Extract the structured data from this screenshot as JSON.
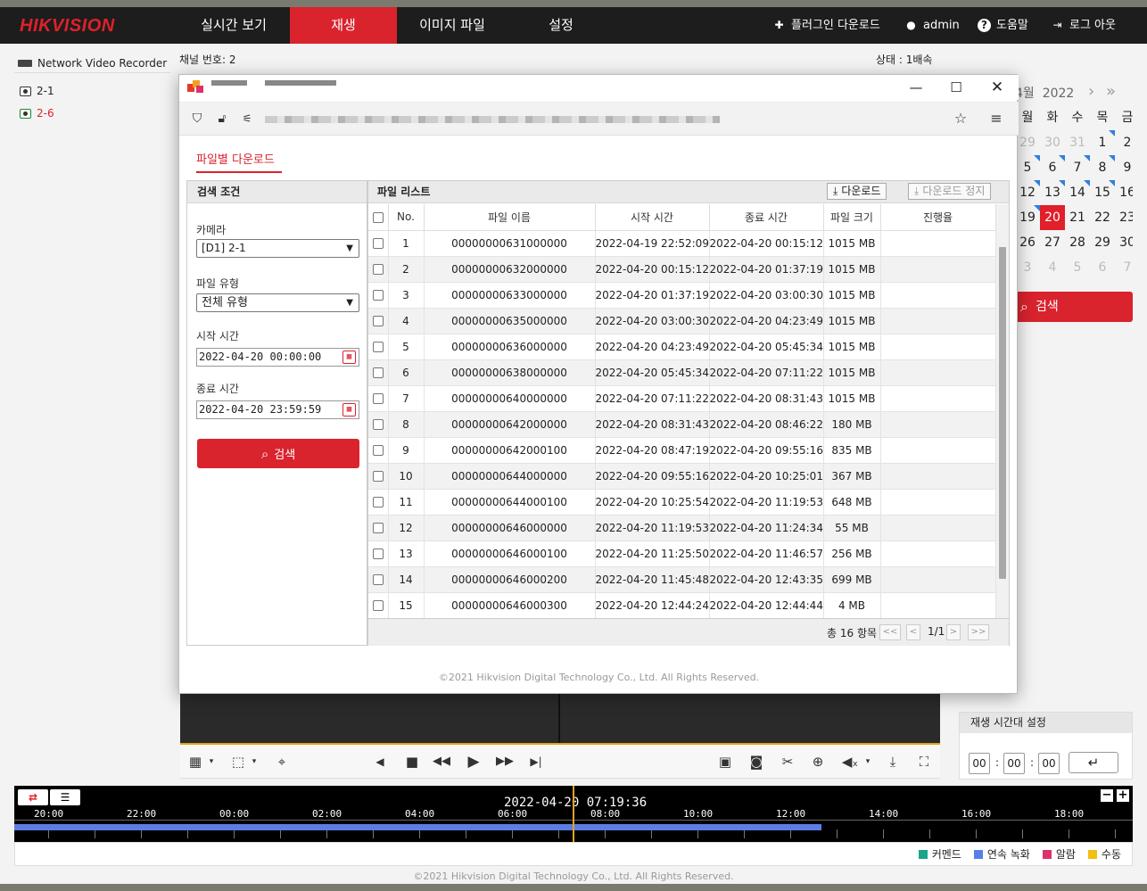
{
  "header": {
    "logo": "HIKVISION",
    "tabs": [
      "실시간 보기",
      "재생",
      "이미지 파일",
      "설정"
    ],
    "active_tab": "재생",
    "plugin": "플러그인 다운로드",
    "user": "admin",
    "help": "도움말",
    "logout": "로그 아웃"
  },
  "sidebar": {
    "device": "Network Video Recorder",
    "cameras": [
      "2-1",
      "2-6"
    ]
  },
  "playback": {
    "channel_label": "채널 번호: 2",
    "status_label": "상태 : 1배속"
  },
  "calendar": {
    "title": "4월  2022",
    "weekdays": [
      "월",
      "화",
      "수",
      "목",
      "금"
    ],
    "weeks": [
      [
        "29",
        "30",
        "31",
        "1",
        "2"
      ],
      [
        "5",
        "6",
        "7",
        "8",
        "9"
      ],
      [
        "12",
        "13",
        "14",
        "15",
        "16"
      ],
      [
        "19",
        "20",
        "21",
        "22",
        "23"
      ],
      [
        "26",
        "27",
        "28",
        "29",
        "30"
      ],
      [
        "3",
        "4",
        "5",
        "6",
        "7"
      ]
    ],
    "selected": "20",
    "search_label": "검색"
  },
  "time_setting": {
    "title": "재생 시간대 설정",
    "hh": "00",
    "mm": "00",
    "ss": "00"
  },
  "timeline": {
    "current_time": "2022-04-20 07:19:36",
    "hours": [
      "20:00",
      "22:00",
      "00:00",
      "02:00",
      "04:00",
      "06:00",
      "08:00",
      "10:00",
      "12:00",
      "14:00",
      "16:00",
      "18:00"
    ],
    "legend": [
      {
        "label": "커멘드",
        "color": "#1aa58a"
      },
      {
        "label": "연속 녹화",
        "color": "#5b7ee6"
      },
      {
        "label": "알람",
        "color": "#e0306a"
      },
      {
        "label": "수동",
        "color": "#f2c012"
      }
    ]
  },
  "footer": "©2021 Hikvision Digital Technology Co., Ltd. All Rights Reserved.",
  "popup": {
    "tab_label": "파일별 다운로드",
    "search_panel": {
      "title": "검색 조건",
      "camera_label": "카메라",
      "camera_value": "[D1] 2-1",
      "file_type_label": "파일 유형",
      "file_type_value": "전체 유형",
      "start_label": "시작 시간",
      "start_value": "2022-04-20 00:00:00",
      "end_label": "종료 시간",
      "end_value": "2022-04-20 23:59:59",
      "search_button": "검색"
    },
    "file_list": {
      "title": "파일 리스트",
      "download_button": "다운로드",
      "stop_button": "다운로드 정지",
      "columns": [
        "No.",
        "파일 이름",
        "시작 시간",
        "종료 시간",
        "파일 크기",
        "진행율"
      ],
      "rows": [
        [
          "1",
          "00000000631000000",
          "2022-04-19 22:52:09",
          "2022-04-20 00:15:12",
          "1015 MB"
        ],
        [
          "2",
          "00000000632000000",
          "2022-04-20 00:15:12",
          "2022-04-20 01:37:19",
          "1015 MB"
        ],
        [
          "3",
          "00000000633000000",
          "2022-04-20 01:37:19",
          "2022-04-20 03:00:30",
          "1015 MB"
        ],
        [
          "4",
          "00000000635000000",
          "2022-04-20 03:00:30",
          "2022-04-20 04:23:49",
          "1015 MB"
        ],
        [
          "5",
          "00000000636000000",
          "2022-04-20 04:23:49",
          "2022-04-20 05:45:34",
          "1015 MB"
        ],
        [
          "6",
          "00000000638000000",
          "2022-04-20 05:45:34",
          "2022-04-20 07:11:22",
          "1015 MB"
        ],
        [
          "7",
          "00000000640000000",
          "2022-04-20 07:11:22",
          "2022-04-20 08:31:43",
          "1015 MB"
        ],
        [
          "8",
          "00000000642000000",
          "2022-04-20 08:31:43",
          "2022-04-20 08:46:22",
          "180 MB"
        ],
        [
          "9",
          "00000000642000100",
          "2022-04-20 08:47:19",
          "2022-04-20 09:55:16",
          "835 MB"
        ],
        [
          "10",
          "00000000644000000",
          "2022-04-20 09:55:16",
          "2022-04-20 10:25:01",
          "367 MB"
        ],
        [
          "11",
          "00000000644000100",
          "2022-04-20 10:25:54",
          "2022-04-20 11:19:53",
          "648 MB"
        ],
        [
          "12",
          "00000000646000000",
          "2022-04-20 11:19:53",
          "2022-04-20 11:24:34",
          "55 MB"
        ],
        [
          "13",
          "00000000646000100",
          "2022-04-20 11:25:50",
          "2022-04-20 11:46:57",
          "256 MB"
        ],
        [
          "14",
          "00000000646000200",
          "2022-04-20 11:45:48",
          "2022-04-20 12:43:35",
          "699 MB"
        ],
        [
          "15",
          "00000000646000300",
          "2022-04-20 12:44:24",
          "2022-04-20 12:44:44",
          "4 MB"
        ]
      ],
      "total": "총 16 항목",
      "page": "1/1",
      "pager_first": "<<",
      "pager_prev": "<",
      "pager_next": ">",
      "pager_last": ">>"
    },
    "copyright": "©2021 Hikvision Digital Technology Co., Ltd. All Rights Reserved."
  }
}
